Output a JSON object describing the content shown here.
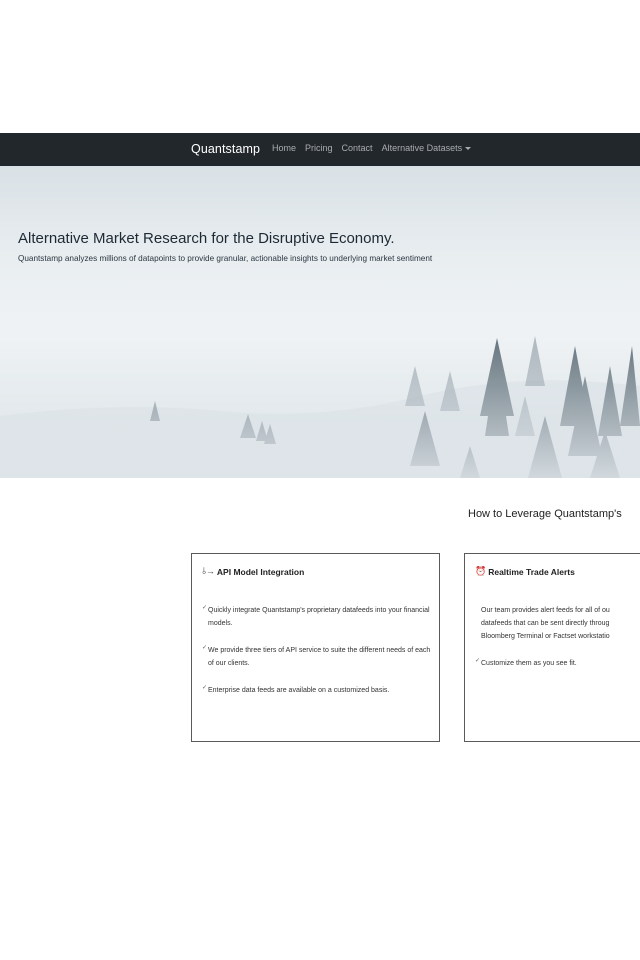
{
  "navbar": {
    "brand": "Quantstamp",
    "links": [
      "Home",
      "Pricing",
      "Contact",
      "Alternative Datasets"
    ]
  },
  "hero": {
    "title": "Alternative Market Research for the Disruptive Economy.",
    "subtitle": "Quantstamp analyzes millions of datapoints to provide granular, actionable insights to underlying market sentiment"
  },
  "section": {
    "heading": "How to Leverage Quantstamp's"
  },
  "cards": [
    {
      "icon": "api-icon",
      "title": "API Model Integration",
      "items": [
        "Quickly integrate Quantstamp's proprietary datafeeds into your financial models.",
        "We provide three tiers of API service to suite the different needs of each of our clients.",
        "Enterprise data feeds are available on a customized basis."
      ]
    },
    {
      "icon": "alarm-icon",
      "title": "Realtime Trade Alerts",
      "items": [
        "Our team provides alert feeds for all of ou",
        "datafeeds that can be sent directly throug",
        "Bloomberg Terminal or Factset workstatio",
        "Customize them as you see fit."
      ]
    }
  ],
  "colors": {
    "navbar_bg": "#22272c",
    "nav_link": "#a9adb1",
    "brand": "#ffffff"
  }
}
